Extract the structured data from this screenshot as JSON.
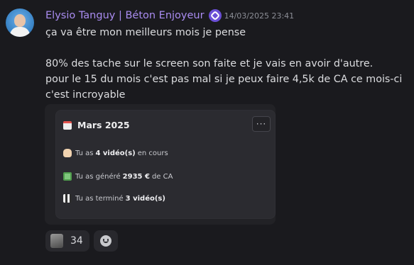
{
  "author": {
    "name": "Elysio Tanguy | Béton Enjoyeur",
    "badge_icon": "server-tag-icon"
  },
  "timestamp": "14/03/2025 23:41",
  "message": {
    "line1": "ça va être mon meilleurs mois je pense",
    "line2": "80% des tache sur le screen son faite et je vais en avoir d'autre.",
    "line3": "pour le 15 du mois c'est pas mal si je peux faire 4,5k de CA ce mois-ci c'est incroyable"
  },
  "card": {
    "title": "Mars 2025",
    "menu": "···",
    "rows": [
      {
        "icon": "raised-hand-icon",
        "prefix": "Tu as",
        "value": "4 vidéo(s)",
        "suffix": "en cours"
      },
      {
        "icon": "money-icon",
        "prefix": "Tu as généré",
        "value": "2935 €",
        "suffix": "de CA"
      },
      {
        "icon": "clapper-icon",
        "prefix": "Tu as terminé",
        "value": "3 vidéo(s)",
        "suffix": ""
      }
    ]
  },
  "reaction": {
    "count": "34",
    "emoji": "custom-emoji-image"
  },
  "colors": {
    "background": "#1a1a1e",
    "username": "#a98cf0",
    "embed": "#222226",
    "card": "#2b2b30"
  }
}
